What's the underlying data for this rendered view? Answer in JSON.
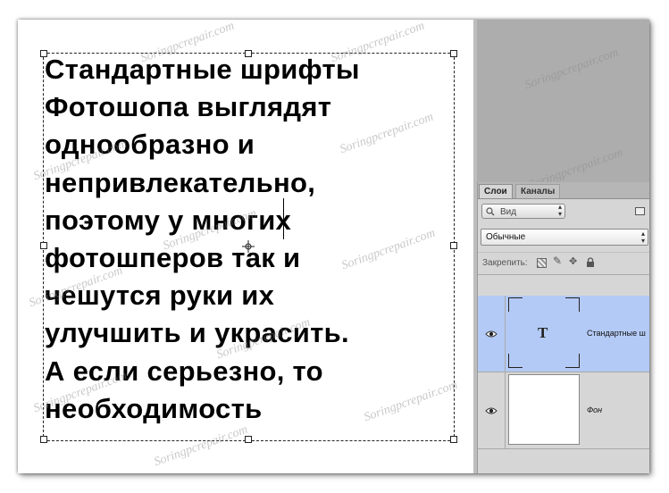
{
  "canvas": {
    "lines": [
      "Стандартные шрифты",
      "Фотошопа выглядят",
      "однообразно и",
      "непривлекательно,",
      "поэтому у многих",
      "фотошперов так и",
      "чешутся руки их",
      "улучшить и украсить.",
      "А если серьезно, то",
      "необходимость"
    ]
  },
  "watermark": "Soringpcrepair.com",
  "layers_panel": {
    "tabs": [
      "Слои",
      "Каналы"
    ],
    "filter_label": "Вид",
    "blend_mode": "Обычные",
    "lock_label": "Закрепить:",
    "layers": [
      {
        "name": "Стандартные ш",
        "thumb_glyph": "T",
        "selected": true
      },
      {
        "name": "Фон",
        "selected": false
      }
    ]
  },
  "colors": {
    "selection": "#b4caf6",
    "workspace": "#adadad",
    "panel": "#d6d6d6"
  }
}
